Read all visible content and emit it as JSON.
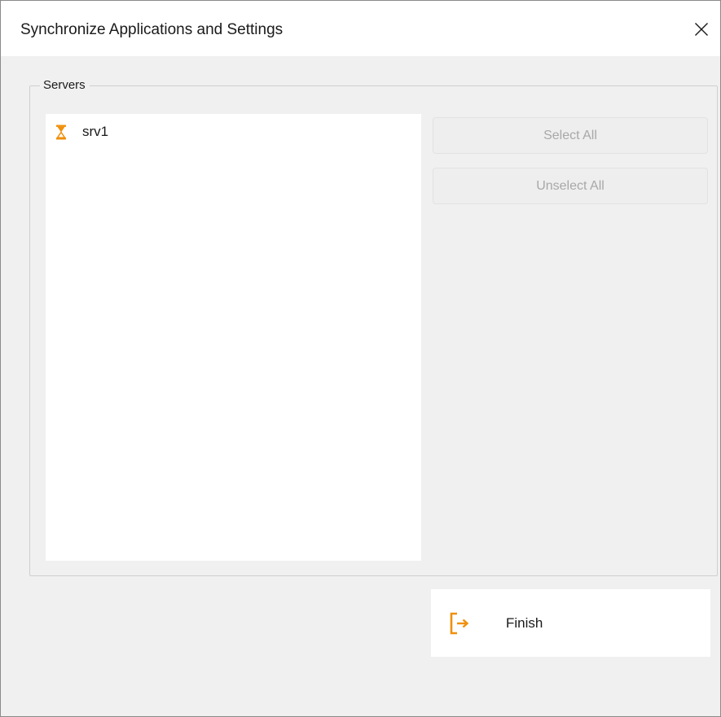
{
  "window": {
    "title": "Synchronize Applications and Settings"
  },
  "icons": {
    "close": "close-icon",
    "server_status": "hourglass-icon",
    "finish": "exit-arrow-icon"
  },
  "colors": {
    "accent_orange": "#f0900c",
    "disabled_text": "#a8a8a8"
  },
  "servers_group": {
    "legend": "Servers",
    "items": [
      {
        "label": "srv1",
        "icon": "hourglass-icon"
      }
    ],
    "select_all_label": "Select All",
    "unselect_all_label": "Unselect All"
  },
  "footer": {
    "finish_label": "Finish"
  }
}
